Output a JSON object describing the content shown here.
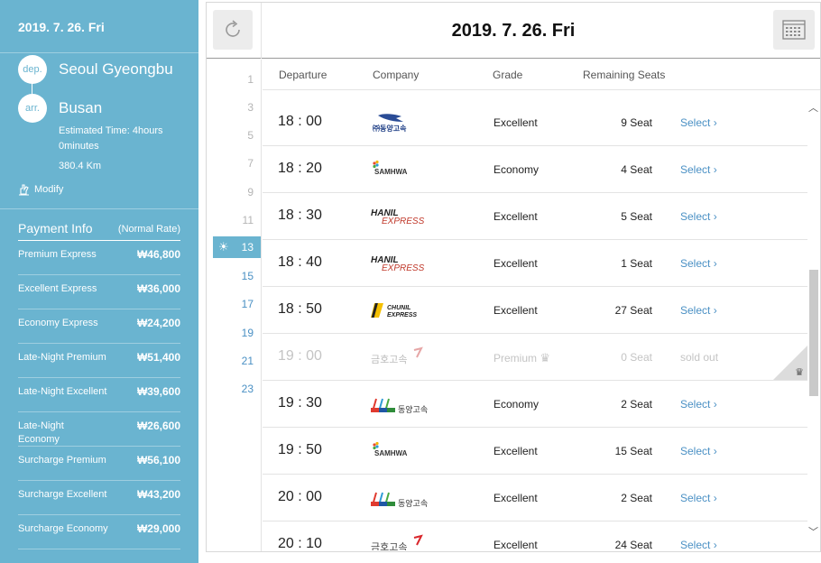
{
  "sidebar": {
    "date": "2019. 7. 26. Fri",
    "dep_badge": "dep.",
    "arr_badge": "arr.",
    "departure": "Seoul Gyeongbu",
    "arrival": "Busan",
    "estimated_time_line1": "Estimated Time: 4hours",
    "estimated_time_line2": "0minutes",
    "distance": "380.4 Km",
    "modify_label": "Modify",
    "payment_title": "Payment Info",
    "normal_rate": "(Normal Rate)",
    "payments": [
      {
        "label": "Premium Express",
        "amount": "₩46,800"
      },
      {
        "label": "Excellent Express",
        "amount": "₩36,000"
      },
      {
        "label": "Economy Express",
        "amount": "₩24,200"
      },
      {
        "label": "Late-Night Premium",
        "amount": "₩51,400"
      },
      {
        "label": "Late-Night Excellent",
        "amount": "₩39,600"
      },
      {
        "label": "Late-Night Economy",
        "amount": "₩26,600"
      },
      {
        "label": "Surcharge Premium",
        "amount": "₩56,100"
      },
      {
        "label": "Surcharge Excellent",
        "amount": "₩43,200"
      },
      {
        "label": "Surcharge Economy",
        "amount": "₩29,000"
      }
    ]
  },
  "header": {
    "date": "2019. 7. 26. Fri",
    "refresh_icon": "refresh-icon",
    "calendar_icon": "calendar-icon"
  },
  "hours": {
    "list": [
      "1",
      "3",
      "5",
      "7",
      "9",
      "11",
      "13",
      "15",
      "17",
      "19",
      "21",
      "23"
    ],
    "active": "13"
  },
  "table": {
    "columns": {
      "departure": "Departure",
      "company": "Company",
      "grade": "Grade",
      "seats": "Remaining Seats"
    },
    "rows": [
      {
        "time": "18 : 00",
        "company_logo": "dongbu-express-logo",
        "grade": "Excellent",
        "seats": "9 Seat",
        "action": "Select"
      },
      {
        "time": "18 : 20",
        "company_logo": "samhwa-logo",
        "logo_text": "SAMHWA",
        "grade": "Economy",
        "seats": "4 Seat",
        "action": "Select"
      },
      {
        "time": "18 : 30",
        "company_logo": "hanil-express-logo",
        "logo_text": "HANIL EXPRESS",
        "grade": "Excellent",
        "seats": "5 Seat",
        "action": "Select"
      },
      {
        "time": "18 : 40",
        "company_logo": "hanil-express-logo",
        "logo_text": "HANIL EXPRESS",
        "grade": "Excellent",
        "seats": "1 Seat",
        "action": "Select"
      },
      {
        "time": "18 : 50",
        "company_logo": "chunil-express-logo",
        "logo_text": "CHUNIL EXPRESS",
        "grade": "Excellent",
        "seats": "27 Seat",
        "action": "Select"
      },
      {
        "time": "19 : 00",
        "company_logo": "kumho-express-logo",
        "logo_text": "금호고속",
        "grade": "Premium",
        "seats": "0 Seat",
        "action": "sold out",
        "sold_out": true
      },
      {
        "time": "19 : 30",
        "company_logo": "dongyang-express-logo",
        "logo_text": "동양고속",
        "grade": "Economy",
        "seats": "2 Seat",
        "action": "Select"
      },
      {
        "time": "19 : 50",
        "company_logo": "samhwa-logo",
        "logo_text": "SAMHWA",
        "grade": "Excellent",
        "seats": "15 Seat",
        "action": "Select"
      },
      {
        "time": "20 : 00",
        "company_logo": "dongyang-express-logo",
        "logo_text": "동양고속",
        "grade": "Excellent",
        "seats": "2 Seat",
        "action": "Select"
      },
      {
        "time": "20 : 10",
        "company_logo": "kumho-express-logo",
        "logo_text": "금호고속",
        "grade": "Excellent",
        "seats": "24 Seat",
        "action": "Select"
      }
    ]
  },
  "colors": {
    "accent": "#6ab4d0",
    "link": "#4a90c4",
    "muted": "#c4c4c4"
  }
}
